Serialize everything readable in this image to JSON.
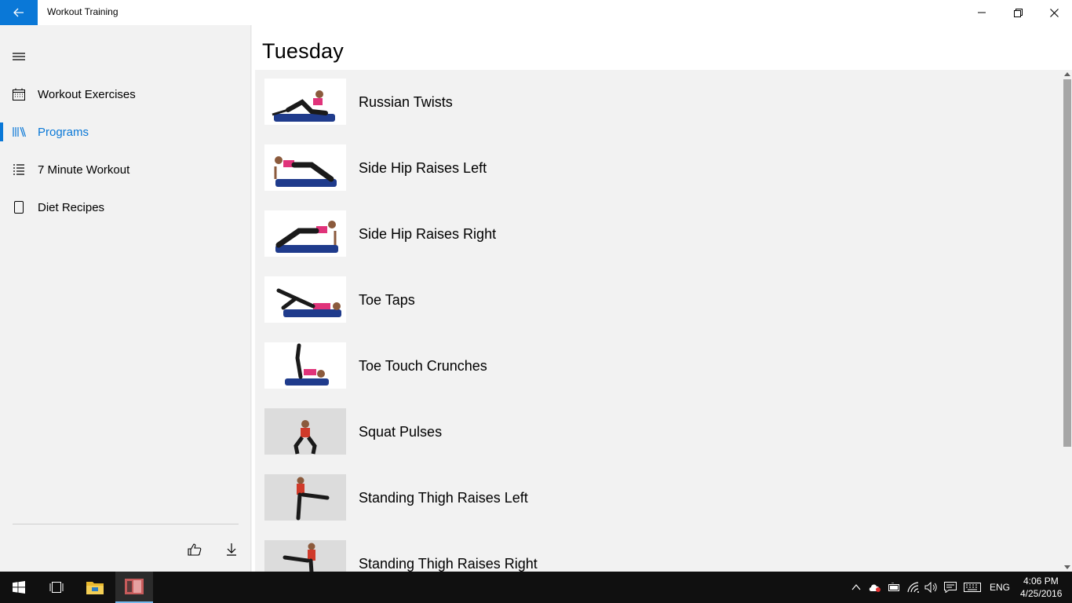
{
  "window": {
    "title": "Workout Training"
  },
  "nav": {
    "items": [
      {
        "label": "Workout Exercises",
        "icon": "calendar-icon",
        "active": false
      },
      {
        "label": "Programs",
        "icon": "library-icon",
        "active": true
      },
      {
        "label": "7 Minute Workout",
        "icon": "list-icon",
        "active": false
      },
      {
        "label": "Diet Recipes",
        "icon": "phone-icon",
        "active": false
      }
    ],
    "footer_icons": [
      "thumbs-up-icon",
      "download-icon"
    ]
  },
  "main": {
    "title": "Tuesday",
    "exercises": [
      {
        "name": "Russian Twists"
      },
      {
        "name": "Side Hip Raises Left"
      },
      {
        "name": "Side Hip Raises Right"
      },
      {
        "name": "Toe Taps"
      },
      {
        "name": "Toe Touch Crunches"
      },
      {
        "name": "Squat Pulses"
      },
      {
        "name": "Standing Thigh Raises Left"
      },
      {
        "name": "Standing Thigh Raises Right"
      }
    ]
  },
  "taskbar": {
    "language": "ENG",
    "time": "4:06 PM",
    "date": "4/25/2016"
  },
  "colors": {
    "accent": "#0a78d7",
    "pane_bg": "#f2f2f2",
    "taskbar_bg": "#101010"
  }
}
